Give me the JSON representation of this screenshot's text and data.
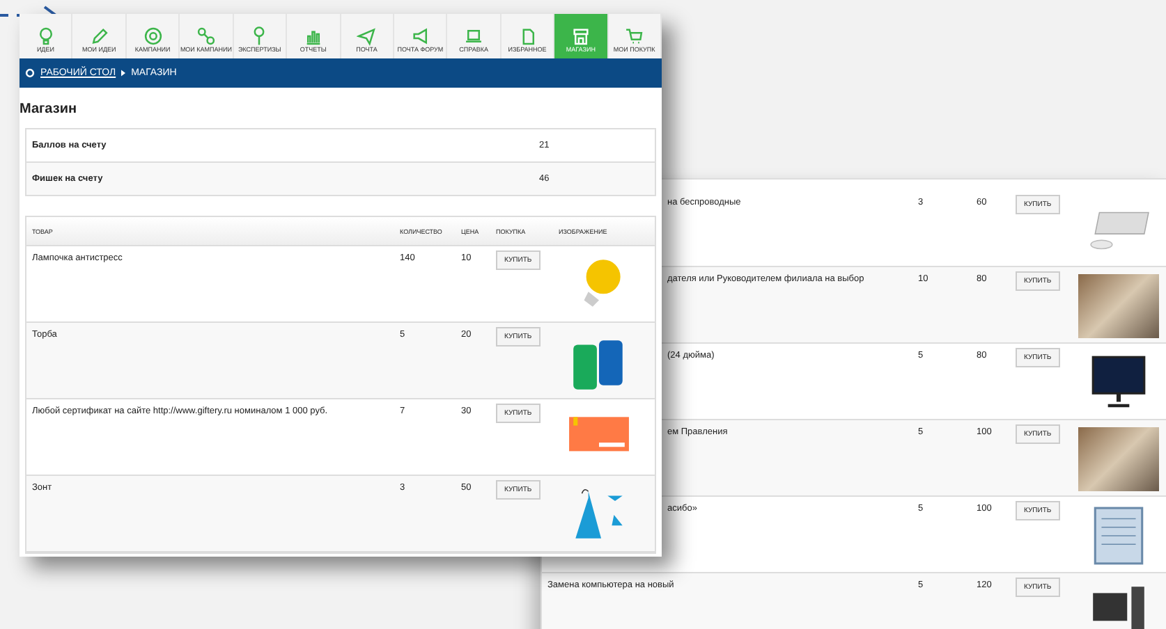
{
  "nav": {
    "tabs": [
      {
        "label": "ИДЕИ",
        "selected": false
      },
      {
        "label": "МОИ ИДЕИ",
        "selected": false
      },
      {
        "label": "КАМПАНИИ",
        "selected": false
      },
      {
        "label": "МОИ КАМПАНИИ",
        "selected": false
      },
      {
        "label": "ЭКСПЕРТИЗЫ",
        "selected": false
      },
      {
        "label": "ОТЧЕТЫ",
        "selected": false
      },
      {
        "label": "ПОЧТА",
        "selected": false
      },
      {
        "label": "ПОЧТА ФОРУМ",
        "selected": false
      },
      {
        "label": "СПРАВКА",
        "selected": false
      },
      {
        "label": "ИЗБРАННОЕ",
        "selected": false
      },
      {
        "label": "МАГАЗИН",
        "selected": true
      },
      {
        "label": "МОИ ПОКУПК",
        "selected": false
      }
    ]
  },
  "breadcrumb": {
    "link": "РАБОЧИЙ СТОЛ",
    "current": "МАГАЗИН"
  },
  "heading": "Магазин",
  "balance": [
    {
      "label": "Баллов на счету",
      "value": "21"
    },
    {
      "label": "Фишек на счету",
      "value": "46"
    }
  ],
  "table": {
    "columns": [
      "ТОВАР",
      "КОЛИЧЕСТВО",
      "ЦЕНА",
      "ПОКУПКА",
      "ИЗОБРАЖЕНИЕ"
    ],
    "rows": [
      {
        "name": "Лампочка антистресс",
        "qty": "140",
        "price": "10",
        "button": "КУПИТЬ",
        "kind": "bulb"
      },
      {
        "name": "Торба",
        "qty": "5",
        "price": "20",
        "button": "КУПИТЬ",
        "kind": "bag"
      },
      {
        "name": "Любой сертификат на сайте http://www.giftery.ru номиналом 1 000 руб.",
        "qty": "7",
        "price": "30",
        "button": "КУПИТЬ",
        "kind": "card"
      },
      {
        "name": "Зонт",
        "qty": "3",
        "price": "50",
        "button": "КУПИТЬ",
        "kind": "umbrella"
      }
    ]
  },
  "back_table": {
    "rows": [
      {
        "name": "на беспроводные",
        "qty": "3",
        "price": "60",
        "button": "КУПИТЬ",
        "kind": "keyboard"
      },
      {
        "name": "дателя или Руководителем филиала на выбор",
        "qty": "10",
        "price": "80",
        "button": "КУПИТЬ",
        "kind": "photo"
      },
      {
        "name": "(24 дюйма)",
        "qty": "5",
        "price": "80",
        "button": "КУПИТЬ",
        "kind": "monitor"
      },
      {
        "name": "ем Правления",
        "qty": "5",
        "price": "100",
        "button": "КУПИТЬ",
        "kind": "photo"
      },
      {
        "name": "асибо»",
        "qty": "5",
        "price": "100",
        "button": "КУПИТЬ",
        "kind": "document"
      },
      {
        "name": "Замена компьютера на новый",
        "qty": "5",
        "price": "120",
        "button": "КУПИТЬ",
        "kind": "computer"
      }
    ]
  }
}
